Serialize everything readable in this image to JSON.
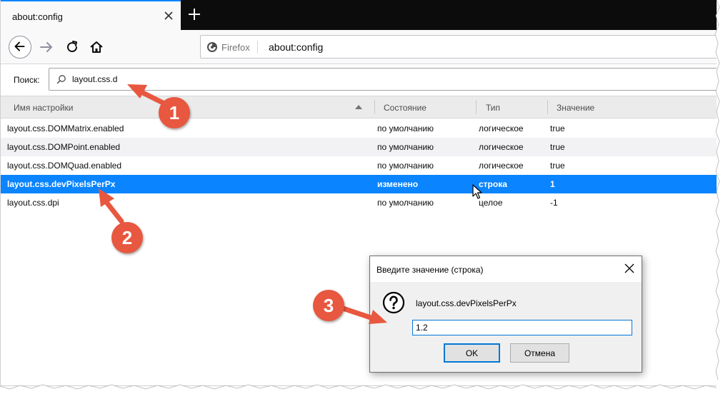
{
  "tab": {
    "title": "about:config"
  },
  "urlbar": {
    "identity_label": "Firefox",
    "url": "about:config"
  },
  "search": {
    "label": "Поиск:",
    "value": "layout.css.d"
  },
  "table": {
    "headers": [
      "Имя настройки",
      "Состояние",
      "Тип",
      "Значение"
    ],
    "rows": [
      {
        "name": "layout.css.DOMMatrix.enabled",
        "status": "по умолчанию",
        "type": "логическое",
        "value": "true"
      },
      {
        "name": "layout.css.DOMPoint.enabled",
        "status": "по умолчанию",
        "type": "логическое",
        "value": "true"
      },
      {
        "name": "layout.css.DOMQuad.enabled",
        "status": "по умолчанию",
        "type": "логическое",
        "value": "true"
      },
      {
        "name": "layout.css.devPixelsPerPx",
        "status": "изменено",
        "type": "строка",
        "value": "1"
      },
      {
        "name": "layout.css.dpi",
        "status": "по умолчанию",
        "type": "целое",
        "value": "-1"
      }
    ]
  },
  "dialog": {
    "title": "Введите значение (строка)",
    "pref_name": "layout.css.devPixelsPerPx",
    "input_value": "1.2",
    "ok_label": "OK",
    "cancel_label": "Отмена"
  },
  "callouts": [
    "1",
    "2",
    "3"
  ],
  "colors": {
    "selected_row": "#0a84ff",
    "callout": "#e8573f",
    "tabstrip": "#0c0c0d"
  },
  "icons": [
    "close-icon",
    "plus-icon",
    "back-arrow-icon",
    "forward-arrow-icon",
    "reload-icon",
    "home-icon",
    "firefox-icon",
    "search-icon",
    "sort-ascending-icon",
    "question-icon",
    "cursor-icon"
  ]
}
